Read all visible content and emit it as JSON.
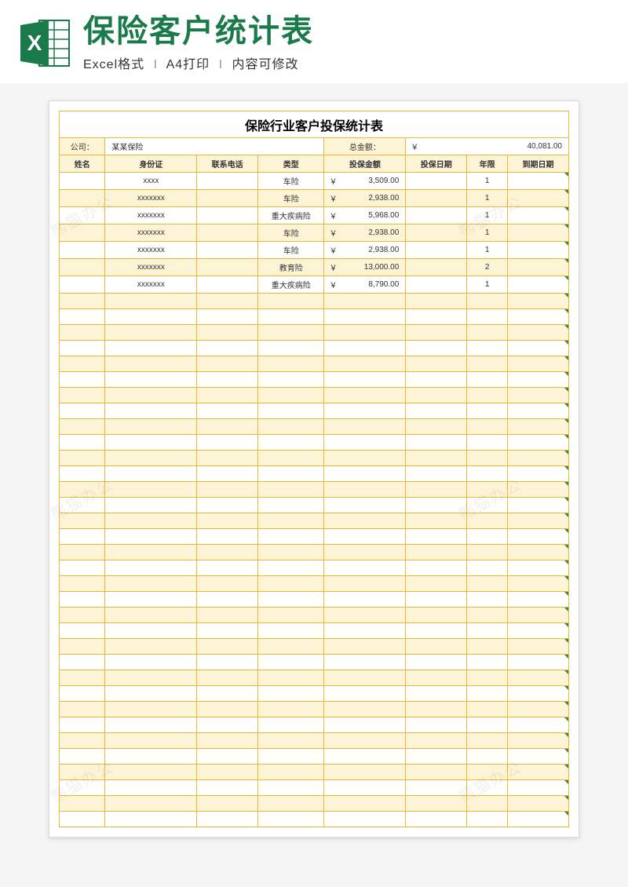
{
  "header": {
    "title": "保险客户统计表",
    "sub1": "Excel格式",
    "sub2": "A4打印",
    "sub3": "内容可修改",
    "icon_label": "X"
  },
  "sheet": {
    "title": "保险行业客户投保统计表",
    "company_label": "公司：",
    "company_value": "某某保险",
    "total_label": "总金额：",
    "currency": "￥",
    "total_value": "40,081.00",
    "columns": [
      "姓名",
      "身份证",
      "联系电话",
      "类型",
      "投保金额",
      "投保日期",
      "年限",
      "到期日期"
    ],
    "rows": [
      {
        "id": "xxxx",
        "type": "车险",
        "amount": "3,509.00",
        "years": "1"
      },
      {
        "id": "xxxxxxx",
        "type": "车险",
        "amount": "2,938.00",
        "years": "1"
      },
      {
        "id": "xxxxxxx",
        "type": "重大疾病险",
        "amount": "5,968.00",
        "years": "1"
      },
      {
        "id": "xxxxxxx",
        "type": "车险",
        "amount": "2,938.00",
        "years": "1"
      },
      {
        "id": "xxxxxxx",
        "type": "车险",
        "amount": "2,938.00",
        "years": "1"
      },
      {
        "id": "xxxxxxx",
        "type": "教育险",
        "amount": "13,000.00",
        "years": "2"
      },
      {
        "id": "xxxxxxx",
        "type": "重大疾病险",
        "amount": "8,790.00",
        "years": "1"
      }
    ],
    "empty_rows": 34
  },
  "watermark": "熊猫办公"
}
